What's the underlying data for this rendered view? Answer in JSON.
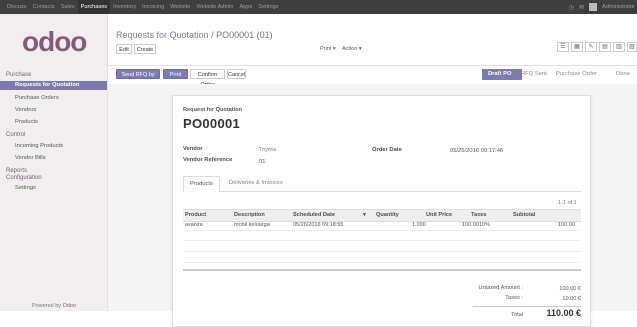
{
  "topbar": {
    "menu": [
      "Discuss",
      "Contacts",
      "Sales",
      "Purchases",
      "Inventory",
      "Invoicing",
      "Website",
      "Website Admin",
      "Apps",
      "Settings"
    ],
    "active_index": 3,
    "user": "Administrator"
  },
  "sidebar": {
    "section_purchase": "Purchase",
    "items_purchase": [
      "Requests for Quotation",
      "Purchase Orders",
      "Vendors",
      "Products"
    ],
    "section_control": "Control",
    "items_control": [
      "Incoming Products",
      "Vendor Bills"
    ],
    "section_reports": "Reports",
    "section_configuration": "Configuration",
    "items_configuration": [
      "Settings"
    ],
    "powered_prefix": "Powered by",
    "powered_brand": "Odoo"
  },
  "logo": "odoo",
  "breadcrumb": {
    "parent": "Requests for Quotation",
    "separator": "/",
    "current": "PO00001 (01)"
  },
  "controls": {
    "edit": "Edit",
    "create": "Create",
    "print": "Print ▾",
    "action": "Action ▾"
  },
  "actions": {
    "send_rfq": "Send RFQ by Email",
    "print_rfq": "Print RFQ",
    "confirm": "Confirm Order",
    "cancel": "Cancel"
  },
  "stages": [
    "Draft PO",
    "RFQ Sent",
    "Purchase Order",
    "Done"
  ],
  "stage_current": 0,
  "form": {
    "doc_type": "Request for Quotation",
    "doc_name": "PO00001",
    "vendor_label": "Vendor",
    "vendor_value": "Toyota",
    "vendor_ref_label": "Vendor Reference",
    "vendor_ref_value": "01",
    "order_date_label": "Order Date",
    "order_date_value": "05/25/2016 09:17:46"
  },
  "tabs": [
    "Products",
    "Deliveries & Invoices"
  ],
  "pager": "1-1 of 1",
  "table": {
    "columns": [
      "Product",
      "Description",
      "Scheduled Date",
      "▾",
      "Quantity",
      "Unit Price",
      "Taxes",
      "Subtotal"
    ],
    "rows": [
      [
        "avanza",
        "mobil keluarga",
        "05/26/2016 09:18:55",
        "",
        "1.000",
        "100.00",
        "10%",
        "100.00"
      ]
    ]
  },
  "totals": {
    "untaxed_label": "Untaxed Amount :",
    "untaxed_value": "100.00 €",
    "taxes_label": "Taxes :",
    "taxes_value": "10.00 €",
    "total_label": "Total",
    "total_value": "110.00 €"
  }
}
